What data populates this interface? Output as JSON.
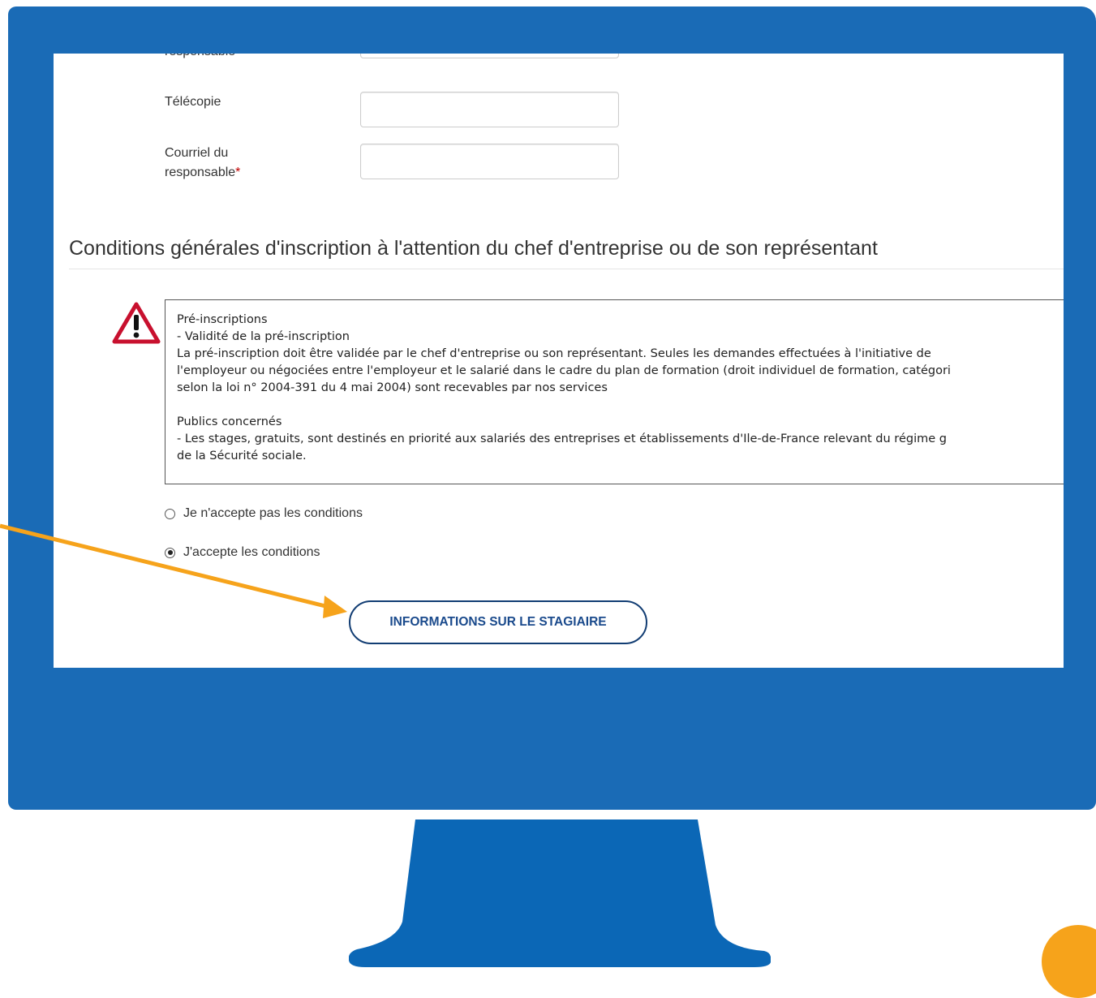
{
  "form": {
    "partial_label": "responsable",
    "fax_label": "Télécopie",
    "email_label_line1": "Courriel du",
    "email_label_line2": "responsable",
    "required_mark": "*"
  },
  "section": {
    "title": "Conditions générales d'inscription à l'attention du chef d'entreprise ou de son représentant"
  },
  "terms": {
    "text": "Pré-inscriptions\n- Validité de la pré-inscription\nLa pré-inscription doit être validée par le chef d'entreprise ou son représentant. Seules les demandes effectuées à l'initiative de\nl'employeur ou négociées entre l'employeur et le salarié dans le cadre du plan de formation (droit individuel de formation, catégori\nselon la loi n° 2004-391 du 4 mai 2004) sont recevables par nos services\n\nPublics concernés\n- Les stages, gratuits, sont destinés en priorité aux salariés des entreprises et établissements d'Ile-de-France relevant du régime g\nde la Sécurité sociale."
  },
  "radios": {
    "decline_label": "Je n'accepte pas les conditions",
    "accept_label": "J'accepte les conditions",
    "selected": "accept"
  },
  "button": {
    "label": "INFORMATIONS SUR LE STAGIAIRE"
  },
  "colors": {
    "monitor": "#1a6bb6",
    "arrow": "#f6a31b",
    "button_text": "#1a4a8c",
    "warning": "#c8102e"
  },
  "icons": {
    "warning": "warning-triangle-icon",
    "annotation": "arrow-pointer"
  }
}
